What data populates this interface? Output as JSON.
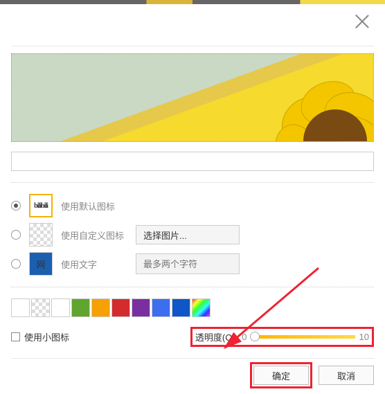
{
  "options": {
    "default_icon": "使用默认图标",
    "custom_icon": "使用自定义图标",
    "use_text": "使用文字"
  },
  "pick_image": "选择图片...",
  "char_placeholder": "最多两个字符",
  "thumb_text": "网",
  "bili": "bilibili",
  "swatches": [
    "#ffffff",
    "trans",
    "#ffffff",
    "#5fa52e",
    "#f6a100",
    "#d22c2c",
    "#7a2fa0",
    "#3d6ef0",
    "#0f56c8",
    "rainbow"
  ],
  "use_small_icon": "使用小图标",
  "opacity": {
    "label": "透明度(O):",
    "min": "0",
    "max": "10"
  },
  "buttons": {
    "ok": "确定",
    "cancel": "取消"
  }
}
